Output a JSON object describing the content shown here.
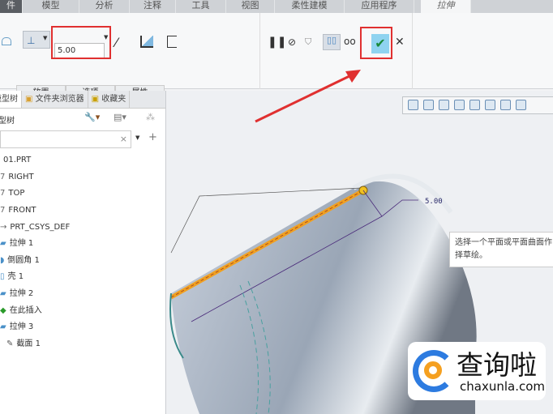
{
  "tabs": [
    "件",
    "模型",
    "分析",
    "注释",
    "工具",
    "视图",
    "柔性建模",
    "应用程序",
    "拉伸"
  ],
  "ribbon": {
    "depth_value": "5.00",
    "subtabs": [
      "放置",
      "选项",
      "属性"
    ]
  },
  "panel": {
    "tabs": [
      "模型树",
      "文件夹浏览器",
      "收藏夹"
    ],
    "header": "模型树",
    "clear": "×",
    "items": [
      {
        "label": "01.PRT",
        "icon": "part-icon"
      },
      {
        "label": "RIGHT",
        "icon": "datum-plane-icon"
      },
      {
        "label": "TOP",
        "icon": "datum-plane-icon"
      },
      {
        "label": "FRONT",
        "icon": "datum-plane-icon"
      },
      {
        "label": "PRT_CSYS_DEF",
        "icon": "csys-icon"
      },
      {
        "label": "拉伸 1",
        "icon": "extrude-icon"
      },
      {
        "label": "倒圆角 1",
        "icon": "round-icon"
      },
      {
        "label": "壳 1",
        "icon": "shell-icon"
      },
      {
        "label": "拉伸 2",
        "icon": "extrude-icon"
      },
      {
        "label": "在此插入",
        "icon": "insert-here-icon"
      },
      {
        "label": "拉伸 3",
        "icon": "extrude-icon"
      },
      {
        "label": "截面 1",
        "icon": "sketch-icon"
      }
    ]
  },
  "viewport": {
    "dimension": "5.00",
    "tooltip": "选择一个平面或平面曲面作为草绘平面或选择草绘。",
    "tooltip_l1": "选择一个平面或平面曲面作",
    "tooltip_l2": "择草绘。"
  },
  "watermark": {
    "name": "查询啦",
    "url": "chaxunla.com"
  },
  "colors": {
    "accent": "#e03030",
    "confirm": "#8fd3f0",
    "feature": "#f0a020"
  }
}
